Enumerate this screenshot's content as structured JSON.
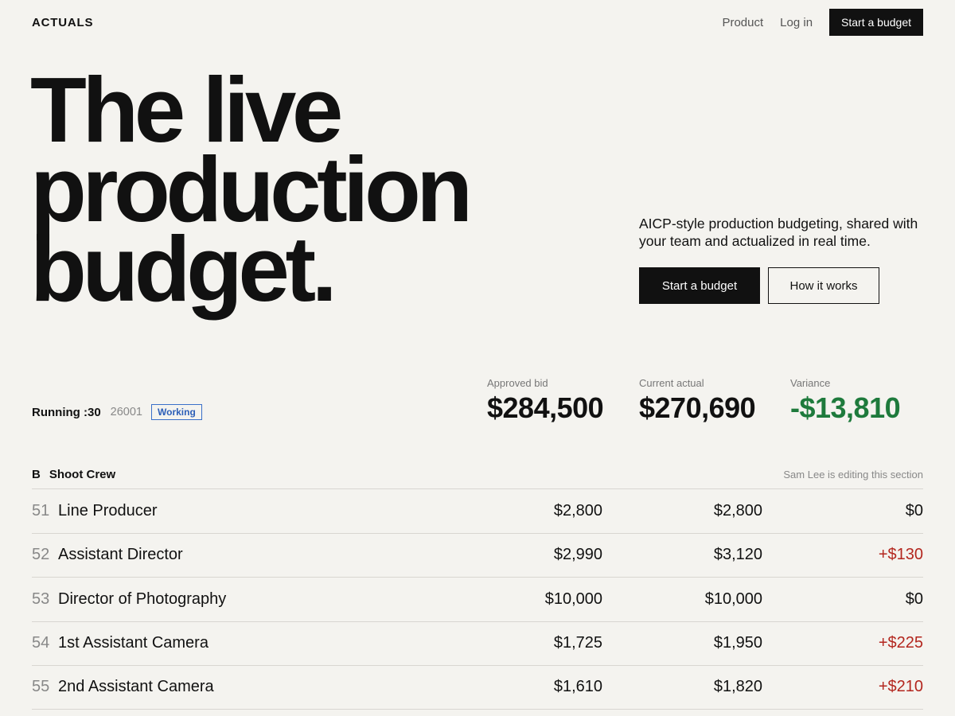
{
  "nav": {
    "brand": "ACTUALS",
    "links": [
      "Product",
      "Log in"
    ],
    "cta": "Start a budget"
  },
  "hero": {
    "title_lines": [
      "The live",
      "production",
      "budget."
    ],
    "subtitle": "AICP-style production budgeting, shared with your team and actualized in real time.",
    "primary_button": "Start a budget",
    "secondary_button": "How it works"
  },
  "project": {
    "spot": "Running :30",
    "code": "26001",
    "status": "Working"
  },
  "metrics": [
    {
      "label": "Approved bid",
      "value": "$284,500"
    },
    {
      "label": "Current actual",
      "value": "$270,690"
    },
    {
      "label": "Variance",
      "value": "-$13,810"
    }
  ],
  "section": {
    "letter": "B",
    "title": "Shoot Crew",
    "note": "Sam Lee is editing this section",
    "rows": [
      {
        "num": "51",
        "name": "Line Producer",
        "bid": "$2,800",
        "actual": "$2,800",
        "variance": "$0"
      },
      {
        "num": "52",
        "name": "Assistant Director",
        "bid": "$2,990",
        "actual": "$3,120",
        "variance": "+$130"
      },
      {
        "num": "53",
        "name": "Director of Photography",
        "bid": "$10,000",
        "actual": "$10,000",
        "variance": "$0"
      },
      {
        "num": "54",
        "name": "1st Assistant Camera",
        "bid": "$1,725",
        "actual": "$1,950",
        "variance": "+$225"
      },
      {
        "num": "55",
        "name": "2nd Assistant Camera",
        "bid": "$1,610",
        "actual": "$1,820",
        "variance": "+$210"
      }
    ]
  },
  "colors": {
    "background": "#f4f3ef",
    "ink": "#111111",
    "variance_negative": "#1e7a3c",
    "variance_positive": "#b3261e",
    "badge": "#2d5fb8"
  }
}
